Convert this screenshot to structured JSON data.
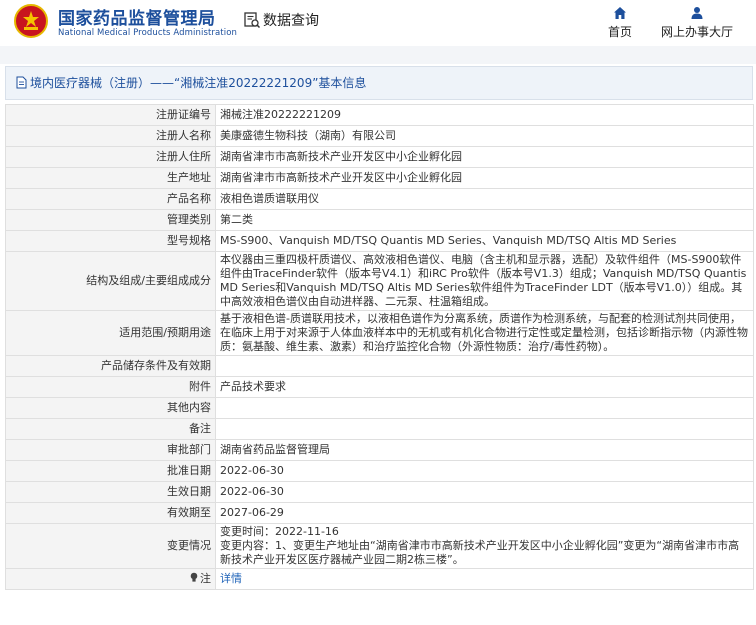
{
  "header": {
    "brand_cn": "国家药品监督管理局",
    "brand_en": "National Medical Products Administration",
    "section_title": "数据查询",
    "nav": [
      {
        "label": "首页",
        "icon": "home-icon"
      },
      {
        "label": "网上办事大厅",
        "icon": "user-icon"
      }
    ]
  },
  "breadcrumb": {
    "text": "境内医疗器械（注册）——“湘械注准20222221209”基本信息"
  },
  "fields": [
    {
      "label": "注册证编号",
      "value": "湘械注准20222221209"
    },
    {
      "label": "注册人名称",
      "value": "美康盛德生物科技（湖南）有限公司"
    },
    {
      "label": "注册人住所",
      "value": "湖南省津市市高新技术产业开发区中小企业孵化园"
    },
    {
      "label": "生产地址",
      "value": "湖南省津市市高新技术产业开发区中小企业孵化园"
    },
    {
      "label": "产品名称",
      "value": "液相色谱质谱联用仪"
    },
    {
      "label": "管理类别",
      "value": "第二类"
    },
    {
      "label": "型号规格",
      "value": "MS-S900、Vanquish MD/TSQ Quantis MD Series、Vanquish MD/TSQ Altis MD Series"
    },
    {
      "label": "结构及组成/主要组成成分",
      "value": "本仪器由三重四极杆质谱仪、高效液相色谱仪、电脑（含主机和显示器，选配）及软件组件（MS-S900软件组件由TraceFinder软件（版本号V4.1）和iRC Pro软件（版本号V1.3）组成；Vanquish MD/TSQ Quantis MD Series和Vanquish MD/TSQ Altis MD Series软件组件为TraceFinder LDT（版本号V1.0））组成。其中高效液相色谱仪由自动进样器、二元泵、柱温箱组成。"
    },
    {
      "label": "适用范围/预期用途",
      "value": "基于液相色谱-质谱联用技术，以液相色谱作为分离系统，质谱作为检测系统，与配套的检测试剂共同使用，在临床上用于对来源于人体血液样本中的无机或有机化合物进行定性或定量检测，包括诊断指示物（内源性物质：氨基酸、维生素、激素）和治疗监控化合物（外源性物质：治疗/毒性药物）。"
    },
    {
      "label": "产品储存条件及有效期",
      "value": ""
    },
    {
      "label": "附件",
      "value": "产品技术要求"
    },
    {
      "label": "其他内容",
      "value": ""
    },
    {
      "label": "备注",
      "value": ""
    },
    {
      "label": "审批部门",
      "value": "湖南省药品监督管理局"
    },
    {
      "label": "批准日期",
      "value": "2022-06-30"
    },
    {
      "label": "生效日期",
      "value": "2022-06-30"
    },
    {
      "label": "有效期至",
      "value": "2027-06-29"
    },
    {
      "label": "变更情况",
      "value": "变更时间：2022-11-16\n变更内容：1、变更生产地址由“湖南省津市市高新技术产业开发区中小企业孵化园”变更为“湖南省津市市高新技术产业开发区医疗器械产业园二期2栋三楼”。"
    }
  ],
  "note": {
    "label": "注",
    "link": "详情",
    "icon": "lightbulb-icon"
  },
  "colors": {
    "brand": "#1d4f9c",
    "logo_red": "#c8141e",
    "link": "#1d62b8",
    "label_bg": "#f4f4f4"
  }
}
